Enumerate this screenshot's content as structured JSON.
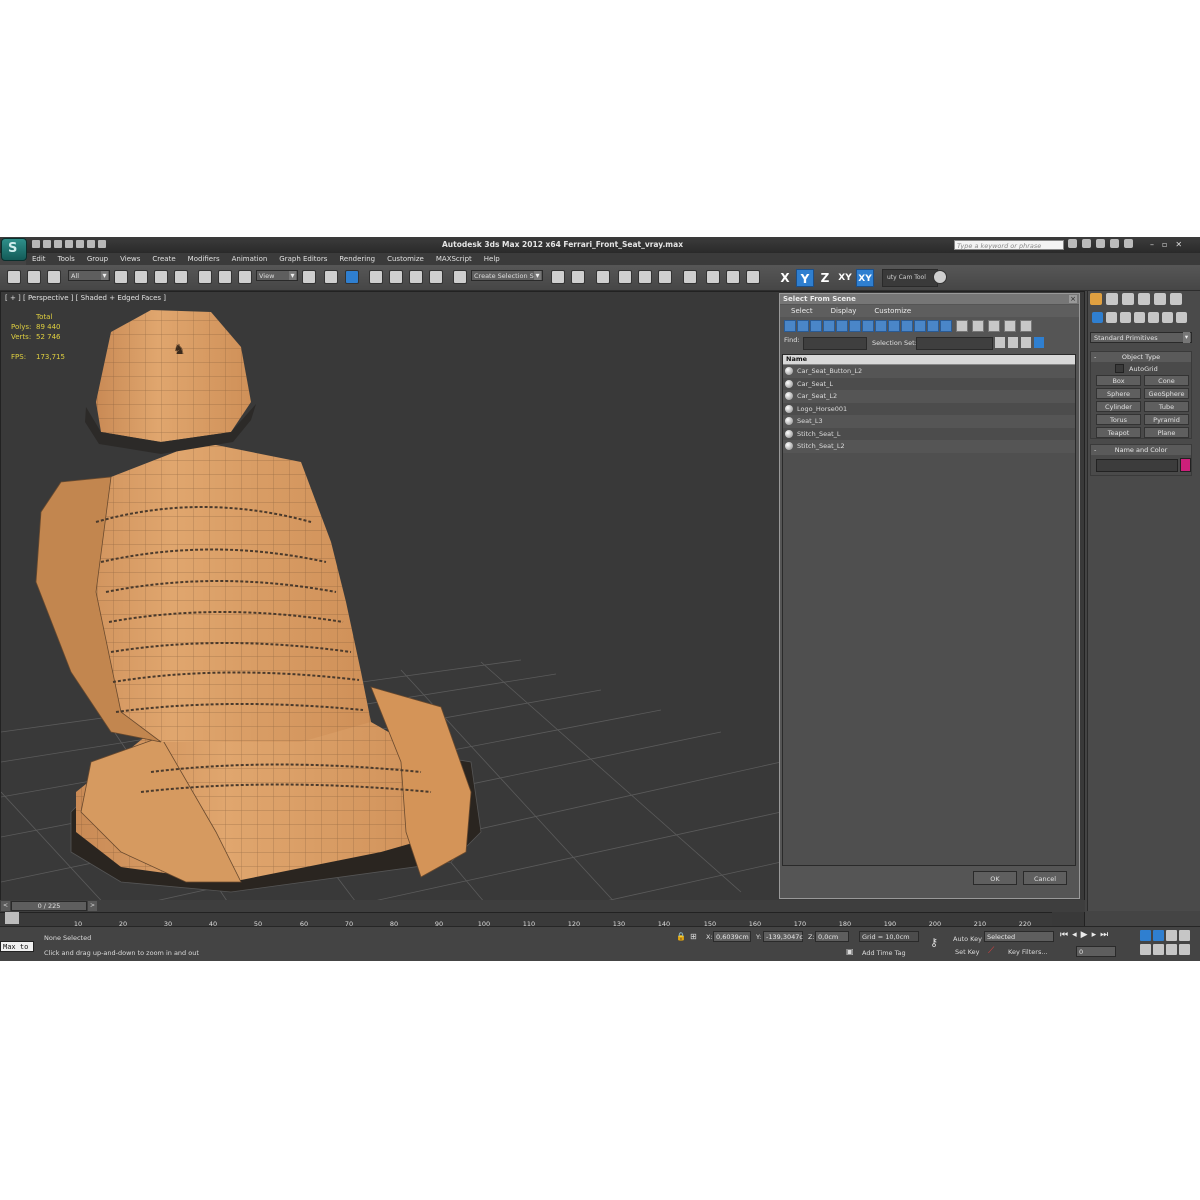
{
  "app": {
    "logo": "S",
    "title": "Autodesk 3ds Max  2012 x64     Ferrari_Front_Seat_vray.max",
    "search_placeholder": "Type a keyword or phrase"
  },
  "menu": [
    "Edit",
    "Tools",
    "Group",
    "Views",
    "Create",
    "Modifiers",
    "Animation",
    "Graph Editors",
    "Rendering",
    "Customize",
    "MAXScript",
    "Help"
  ],
  "toolbar": {
    "selection_filter": "All",
    "reference_coord": "View",
    "create_selection_set": "Create Selection Se",
    "axis_x": "X",
    "axis_y": "Y",
    "axis_z": "Z",
    "axis_xy": "XY",
    "axis_xy_active": "XY",
    "cam_tool": "uty Cam Tool"
  },
  "viewport": {
    "label": "[ + ] [ Perspective ] [ Shaded + Edged Faces ]",
    "stats": {
      "header": "Total",
      "polys_label": "Polys:",
      "polys": "89 440",
      "verts_label": "Verts:",
      "verts": "52 746",
      "fps_label": "FPS:",
      "fps": "173,715"
    },
    "material_color": "#dca06a"
  },
  "dialog": {
    "title": "Select From Scene",
    "menu": [
      "Select",
      "Display",
      "Customize"
    ],
    "find_label": "Find:",
    "selection_set_label": "Selection Set:",
    "column": "Name",
    "objects": [
      "Car_Seat_Button_L2",
      "Car_Seat_L",
      "Car_Seat_L2",
      "Logo_Horse001",
      "Seat_L3",
      "Stitch_Seat_L",
      "Stitch_Seat_L2"
    ],
    "ok": "OK",
    "cancel": "Cancel"
  },
  "command_panel": {
    "category": "Standard Primitives",
    "object_type_header": "Object Type",
    "autogrid": "AutoGrid",
    "buttons": [
      "Box",
      "Cone",
      "Sphere",
      "GeoSphere",
      "Cylinder",
      "Tube",
      "Torus",
      "Pyramid",
      "Teapot",
      "Plane"
    ],
    "name_color_header": "Name and Color",
    "swatch_color": "#cc1f7a"
  },
  "timeline": {
    "position": "0 / 225",
    "ticks": [
      "10",
      "20",
      "30",
      "40",
      "50",
      "60",
      "70",
      "80",
      "90",
      "100",
      "110",
      "120",
      "130",
      "140",
      "150",
      "160",
      "170",
      "180",
      "190",
      "200",
      "210",
      "220"
    ]
  },
  "status": {
    "maxscript": "Max to",
    "selection": "None Selected",
    "prompt": "Click and drag up-and-down to zoom in and out",
    "x_label": "X:",
    "x": "0,6039cm",
    "y_label": "Y:",
    "y": "-139,3047c",
    "z_label": "Z:",
    "z": "0,0cm",
    "grid": "Grid = 10,0cm",
    "add_time_tag": "Add Time Tag",
    "auto_key": "Auto Key",
    "set_key": "Set Key",
    "selected": "Selected",
    "key_filters": "Key Filters...",
    "frame": "0"
  }
}
